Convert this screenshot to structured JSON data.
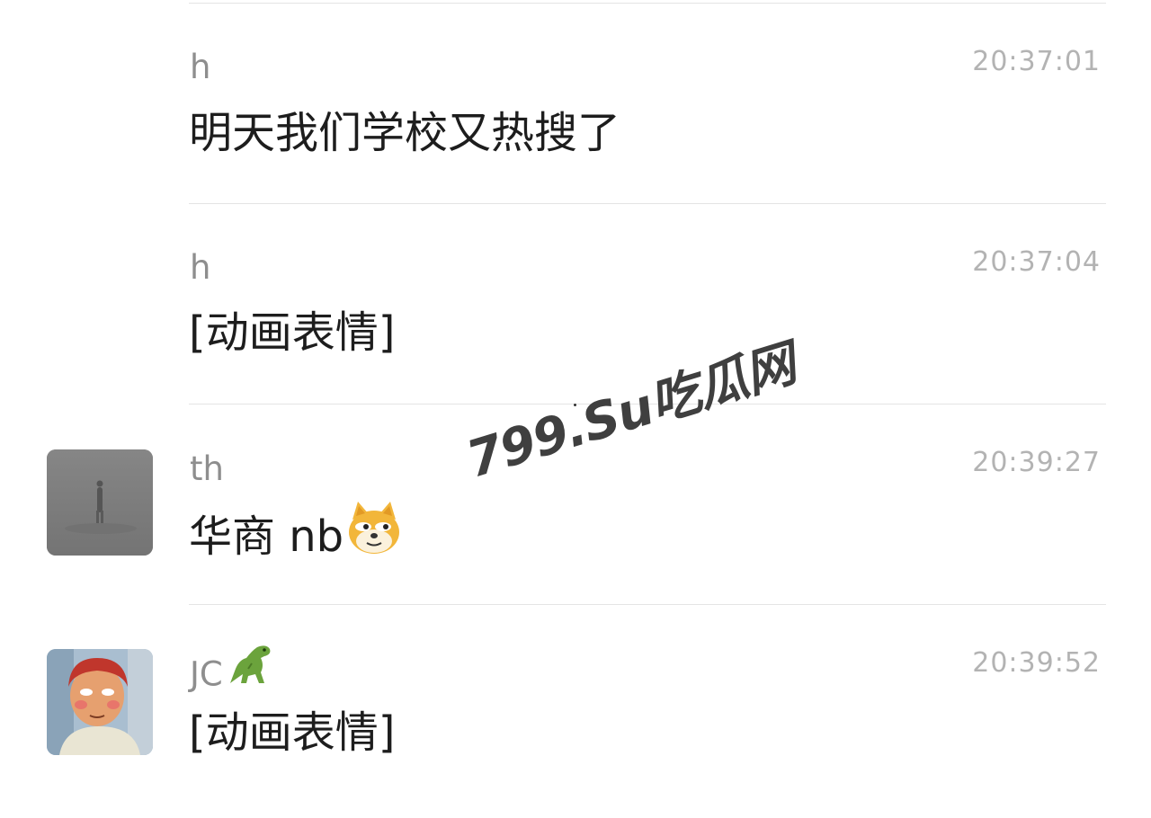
{
  "messages": [
    {
      "sender": "h",
      "time": "20:37:01",
      "text": "明天我们学校又热搜了",
      "avatar": "none"
    },
    {
      "sender": "h",
      "time": "20:37:04",
      "text": "[动画表情]",
      "avatar": "none"
    },
    {
      "sender": "th",
      "time": "20:39:27",
      "text": "华商 nb",
      "text_emoji": "doge-emoji",
      "avatar": "gray-figure-in-fog-avatar"
    },
    {
      "sender": "JC",
      "sender_emoji": "dinosaur-emoji",
      "time": "20:39:52",
      "text": "[动画表情]",
      "avatar": "cartoon-character-avatar"
    }
  ],
  "watermark": "799.Su吃瓜网",
  "colors": {
    "sender": "#8e8e8e",
    "time": "#b3b3b3",
    "text": "#1d1d1d",
    "divider": "#e4e4e4",
    "watermark": "#3f3f3f"
  }
}
